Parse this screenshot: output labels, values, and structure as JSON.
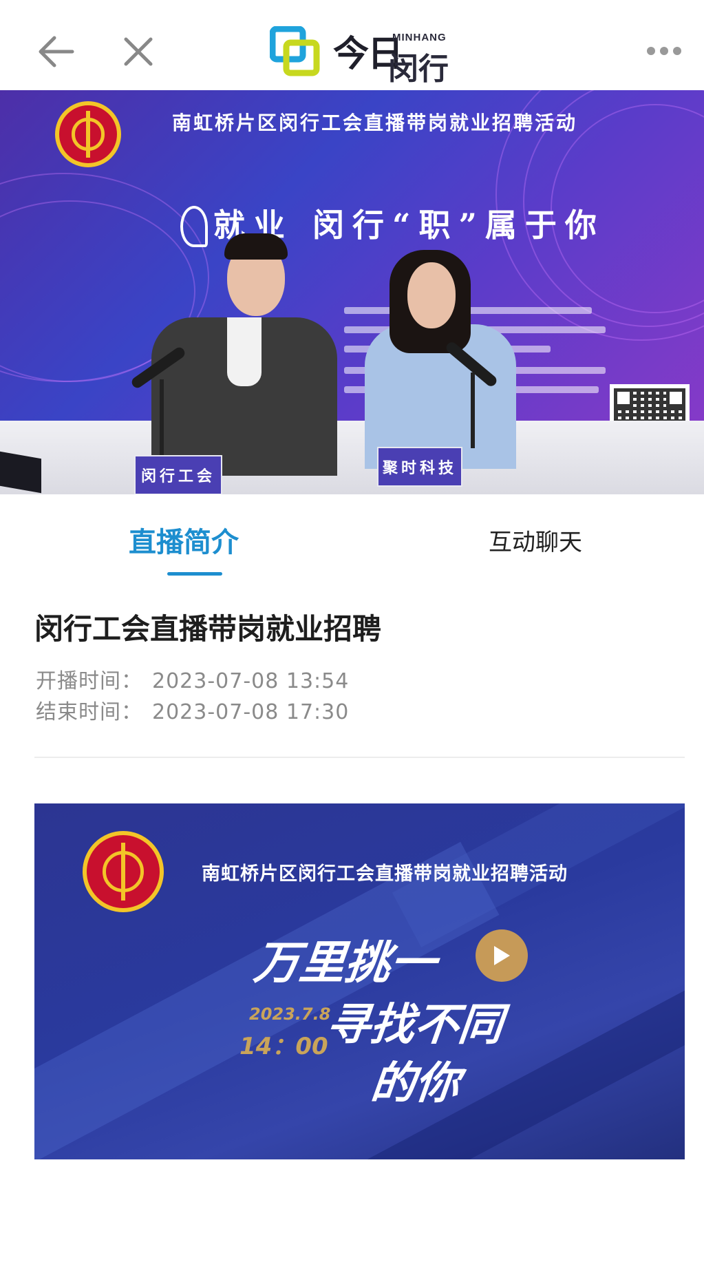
{
  "header": {
    "logo_text": "今日",
    "logo_eng": "MINHANG",
    "logo_cn": "闵行"
  },
  "video": {
    "banner_title": "南虹桥片区闵行工会直播带岗就业招聘活动",
    "slogan": "就业 闵行“职”属于你",
    "left_nameplate": "闵行工会",
    "right_nameplate": "聚时科技"
  },
  "tabs": [
    {
      "label": "直播简介",
      "active": true
    },
    {
      "label": "互动聊天",
      "active": false
    }
  ],
  "event": {
    "title": "闵行工会直播带岗就业招聘",
    "start_label": "开播时间：",
    "start_time": "2023-07-08 13:54",
    "end_label": "结束时间：",
    "end_time": "2023-07-08 17:30"
  },
  "poster": {
    "title": "南虹桥片区闵行工会直播带岗就业招聘活动",
    "headline_1": "万里挑一",
    "headline_2": "寻找不同",
    "headline_3": "的你",
    "date": "2023.7.8",
    "time": "14：00"
  },
  "colors": {
    "accent": "#1d8ecf",
    "muted_text": "#8a8a8a",
    "poster_bg": "#2a3a9e",
    "play_button": "#c69a58"
  }
}
